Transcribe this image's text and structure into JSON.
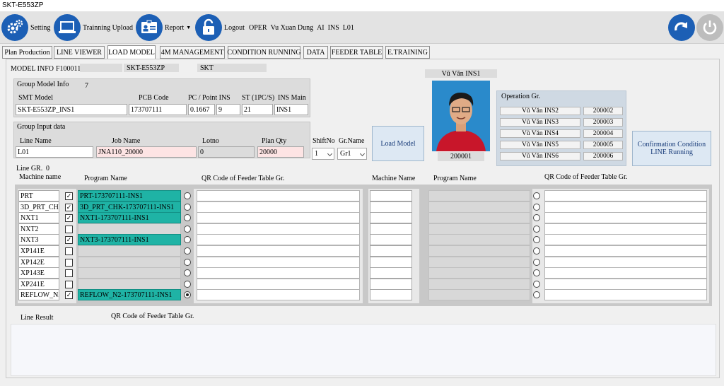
{
  "window": {
    "title": "SKT-E553ZP"
  },
  "toolbar": {
    "setting": "Setting",
    "training_upload": "Trainning Upload",
    "report": "Report",
    "logout": "Logout",
    "user_role": "OPER",
    "user_name": "Vu Xuan Dung",
    "user_type": "AI",
    "user_group": "INS",
    "user_line": "L01",
    "accent": "#1c5fb5"
  },
  "tabs": [
    "Plan Production",
    "LINE VIEWER",
    "LOAD MODEL",
    "4M MANAGEMENT",
    "CONDITION RUNNING",
    "DATA",
    "FEEDER TABLE",
    "E.TRAINING"
  ],
  "model_info": {
    "label": "MODEL INFO",
    "code": "F100011",
    "model": "SKT-E553ZP",
    "customer": "SKT"
  },
  "group_model": {
    "title": "Group Model Info",
    "count": "7",
    "headers": {
      "smt_model": "SMT Model",
      "pcb_code": "PCB Code",
      "pc_point": "PC / Point INS",
      "st": "ST (1PC/S)",
      "ins_main": "INS Main"
    },
    "values": {
      "smt_model": "SKT-E553ZP_INS1",
      "pcb_code": "173707111",
      "pc": "0.1667",
      "point": "9",
      "st": "21",
      "ins_main": "INS1"
    }
  },
  "group_input": {
    "title": "Group Input data",
    "headers": {
      "line_name": "Line Name",
      "job_name": "Job Name",
      "lotno": "Lotno",
      "plan_qty": "Plan Qty"
    },
    "values": {
      "line_name": "L01",
      "job_name": "JNA110_20000",
      "lotno": "0",
      "plan_qty": "20000"
    }
  },
  "shift": {
    "label": "ShiftNo",
    "value": "1"
  },
  "grname": {
    "label": "Gr.Name",
    "value": "Gr1"
  },
  "load_model_button": "Load Model",
  "operator": {
    "name": "Vũ Văn INS1",
    "id": "200001"
  },
  "operation_gr": {
    "title": "Operation Gr.",
    "rows": [
      {
        "name": "Vũ Văn INS2",
        "id": "200002"
      },
      {
        "name": "Vũ Văn INS3",
        "id": "200003"
      },
      {
        "name": "Vũ Văn INS4",
        "id": "200004"
      },
      {
        "name": "Vũ Văn INS5",
        "id": "200005"
      },
      {
        "name": "Vũ Văn INS6",
        "id": "200006"
      }
    ]
  },
  "confirm_button": {
    "line1": "Confirmation Condition",
    "line2": "LINE Running"
  },
  "line_gr": {
    "label": "Line GR.",
    "count": "0",
    "headers": {
      "machine": "Machine name",
      "program": "Program Name",
      "qr": "QR Code of Feeder Table Gr."
    },
    "right_headers": {
      "machine": "Machine Name",
      "program": "Program Name",
      "qr": "QR Code of Feeder Table Gr."
    },
    "rows": [
      {
        "machine": "PRT",
        "checked": true,
        "program": "PRT-173707111-INS1",
        "selected": false
      },
      {
        "machine": "3D_PRT_CHK",
        "checked": true,
        "program": "3D_PRT_CHK-173707111-INS1",
        "selected": false
      },
      {
        "machine": "NXT1",
        "checked": true,
        "program": "NXT1-173707111-INS1",
        "selected": false
      },
      {
        "machine": "NXT2",
        "checked": false,
        "program": "",
        "selected": false
      },
      {
        "machine": "NXT3",
        "checked": true,
        "program": "NXT3-173707111-INS1",
        "selected": false
      },
      {
        "machine": "XP141E",
        "checked": false,
        "program": "",
        "selected": false
      },
      {
        "machine": "XP142E",
        "checked": false,
        "program": "",
        "selected": false
      },
      {
        "machine": "XP143E",
        "checked": false,
        "program": "",
        "selected": false
      },
      {
        "machine": "XP241E",
        "checked": false,
        "program": "",
        "selected": false
      },
      {
        "machine": "REFLOW_N2",
        "checked": true,
        "program": "REFLOW_N2-173707111-INS1",
        "selected": true
      }
    ]
  },
  "line_result": {
    "label": "Line Result",
    "qr_label": "QR Code of Feeder Table Gr."
  },
  "colors": {
    "program_filled": "#1fb3a5",
    "pink_field": "#fde4e4"
  }
}
